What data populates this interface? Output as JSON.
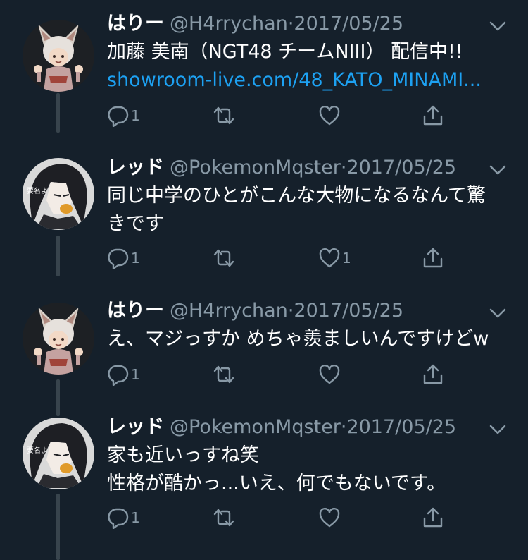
{
  "tweets": [
    {
      "name": "はりー",
      "handle": "@H4rrychan",
      "separator": "·",
      "date": "2017/05/25",
      "body_lines": [
        "加藤 美南（NGT48 チームNIII） 配信中!!"
      ],
      "link": "showroom-live.com/48_KATO_MINAMI...",
      "reply_count": "1",
      "retweet_count": "",
      "like_count": "",
      "avatar": "fox-ear-girl-avatar"
    },
    {
      "name": "レッド",
      "handle": "@PokemonMqster",
      "separator": "·",
      "date": "2017/05/25",
      "body_lines": [
        "同じ中学のひとがこんな大物になるなんて驚",
        "きです"
      ],
      "link": "",
      "reply_count": "1",
      "retweet_count": "",
      "like_count": "1",
      "avatar": "dark-hair-boy-avatar",
      "avatar_caption": "要名よ"
    },
    {
      "name": "はりー",
      "handle": "@H4rrychan",
      "separator": "·",
      "date": "2017/05/25",
      "body_lines": [
        "え、マジっすか めちゃ羨ましいんですけどw"
      ],
      "link": "",
      "reply_count": "1",
      "retweet_count": "",
      "like_count": "",
      "avatar": "fox-ear-girl-avatar"
    },
    {
      "name": "レッド",
      "handle": "@PokemonMqster",
      "separator": "·",
      "date": "2017/05/25",
      "body_lines": [
        "家も近いっすね笑",
        "性格が酷かっ...いえ、何でもないです。"
      ],
      "link": "",
      "reply_count": "1",
      "retweet_count": "",
      "like_count": "",
      "avatar": "dark-hair-boy-avatar",
      "avatar_caption": "要名よ"
    }
  ],
  "colors": {
    "background": "#15202b",
    "secondary_text": "#8899a6",
    "link": "#1da1f2",
    "thread_line": "#38444d"
  }
}
